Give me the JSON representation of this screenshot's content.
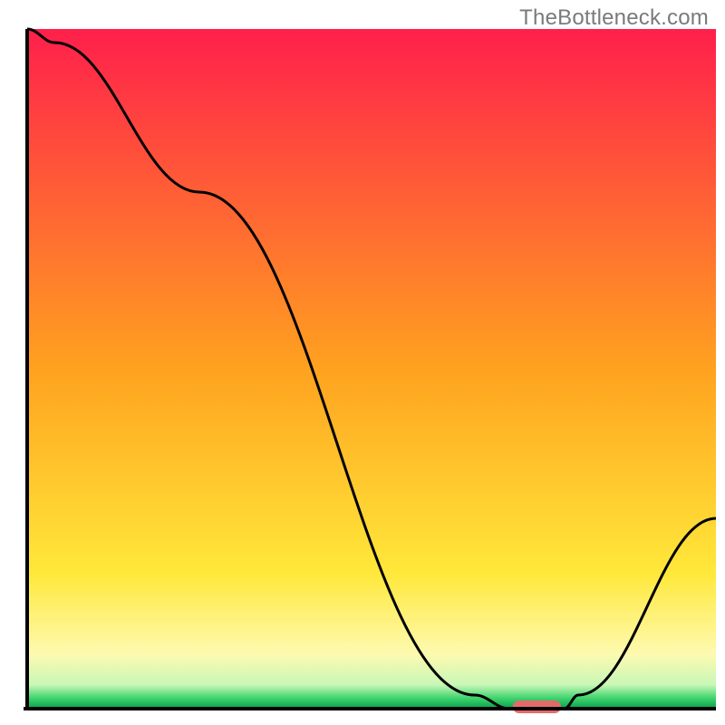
{
  "watermark": "TheBottleneck.com",
  "chart_data": {
    "type": "line",
    "title": "",
    "xlabel": "",
    "ylabel": "",
    "xlim": [
      0,
      100
    ],
    "ylim": [
      0,
      100
    ],
    "x": [
      0,
      4,
      25,
      65,
      70,
      78,
      80,
      100
    ],
    "values": [
      100,
      98,
      76,
      2,
      0,
      0,
      2,
      28
    ],
    "marker": {
      "x": 74,
      "width": 7
    },
    "colors": {
      "gradient_stops": [
        {
          "pos": 0.0,
          "color": "#ff1f4b"
        },
        {
          "pos": 0.5,
          "color": "#ffa21f"
        },
        {
          "pos": 0.8,
          "color": "#ffe83a"
        },
        {
          "pos": 0.92,
          "color": "#fdfab0"
        },
        {
          "pos": 0.965,
          "color": "#c8f7b7"
        },
        {
          "pos": 0.985,
          "color": "#3cd26c"
        },
        {
          "pos": 1.0,
          "color": "#07a04a"
        }
      ],
      "line": "#000000",
      "axis": "#000000",
      "marker": "#e46a6a"
    }
  }
}
